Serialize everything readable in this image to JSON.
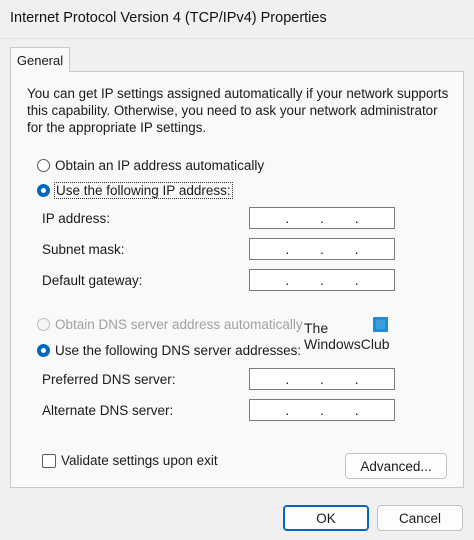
{
  "window": {
    "title": "Internet Protocol Version 4 (TCP/IPv4) Properties"
  },
  "tabs": [
    {
      "label": "General"
    }
  ],
  "description": {
    "lines": [
      "You can get IP settings assigned automatically if your network supports",
      "this capability. Otherwise, you need to ask your network administrator",
      "for the appropriate IP settings."
    ]
  },
  "ip": {
    "auto_label": "Obtain an IP address automatically",
    "manual_label": "Use the following IP address:",
    "selected": "manual",
    "fields": [
      {
        "label": "IP address:",
        "value": ""
      },
      {
        "label": "Subnet mask:",
        "value": ""
      },
      {
        "label": "Default gateway:",
        "value": ""
      }
    ]
  },
  "dns": {
    "auto_label": "Obtain DNS server address automatically",
    "auto_disabled": true,
    "manual_label": "Use the following DNS server addresses:",
    "selected": "manual",
    "fields": [
      {
        "label": "Preferred DNS server:",
        "value": ""
      },
      {
        "label": "Alternate DNS server:",
        "value": ""
      }
    ]
  },
  "validate": {
    "label": "Validate settings upon exit",
    "checked": false
  },
  "buttons": {
    "advanced": "Advanced...",
    "ok": "OK",
    "cancel": "Cancel"
  },
  "watermark": {
    "line1": "The",
    "line2": "WindowsClub"
  },
  "colors": {
    "accent": "#0067c0",
    "disabled_text": "#a0a0a0",
    "background": "#f0f0f0",
    "panel": "#f9f9f9"
  },
  "icons": {
    "radio_selected": "radio-selected-icon",
    "checkbox": "checkbox-icon",
    "watermark_logo": "windowsclub-logo-icon"
  }
}
